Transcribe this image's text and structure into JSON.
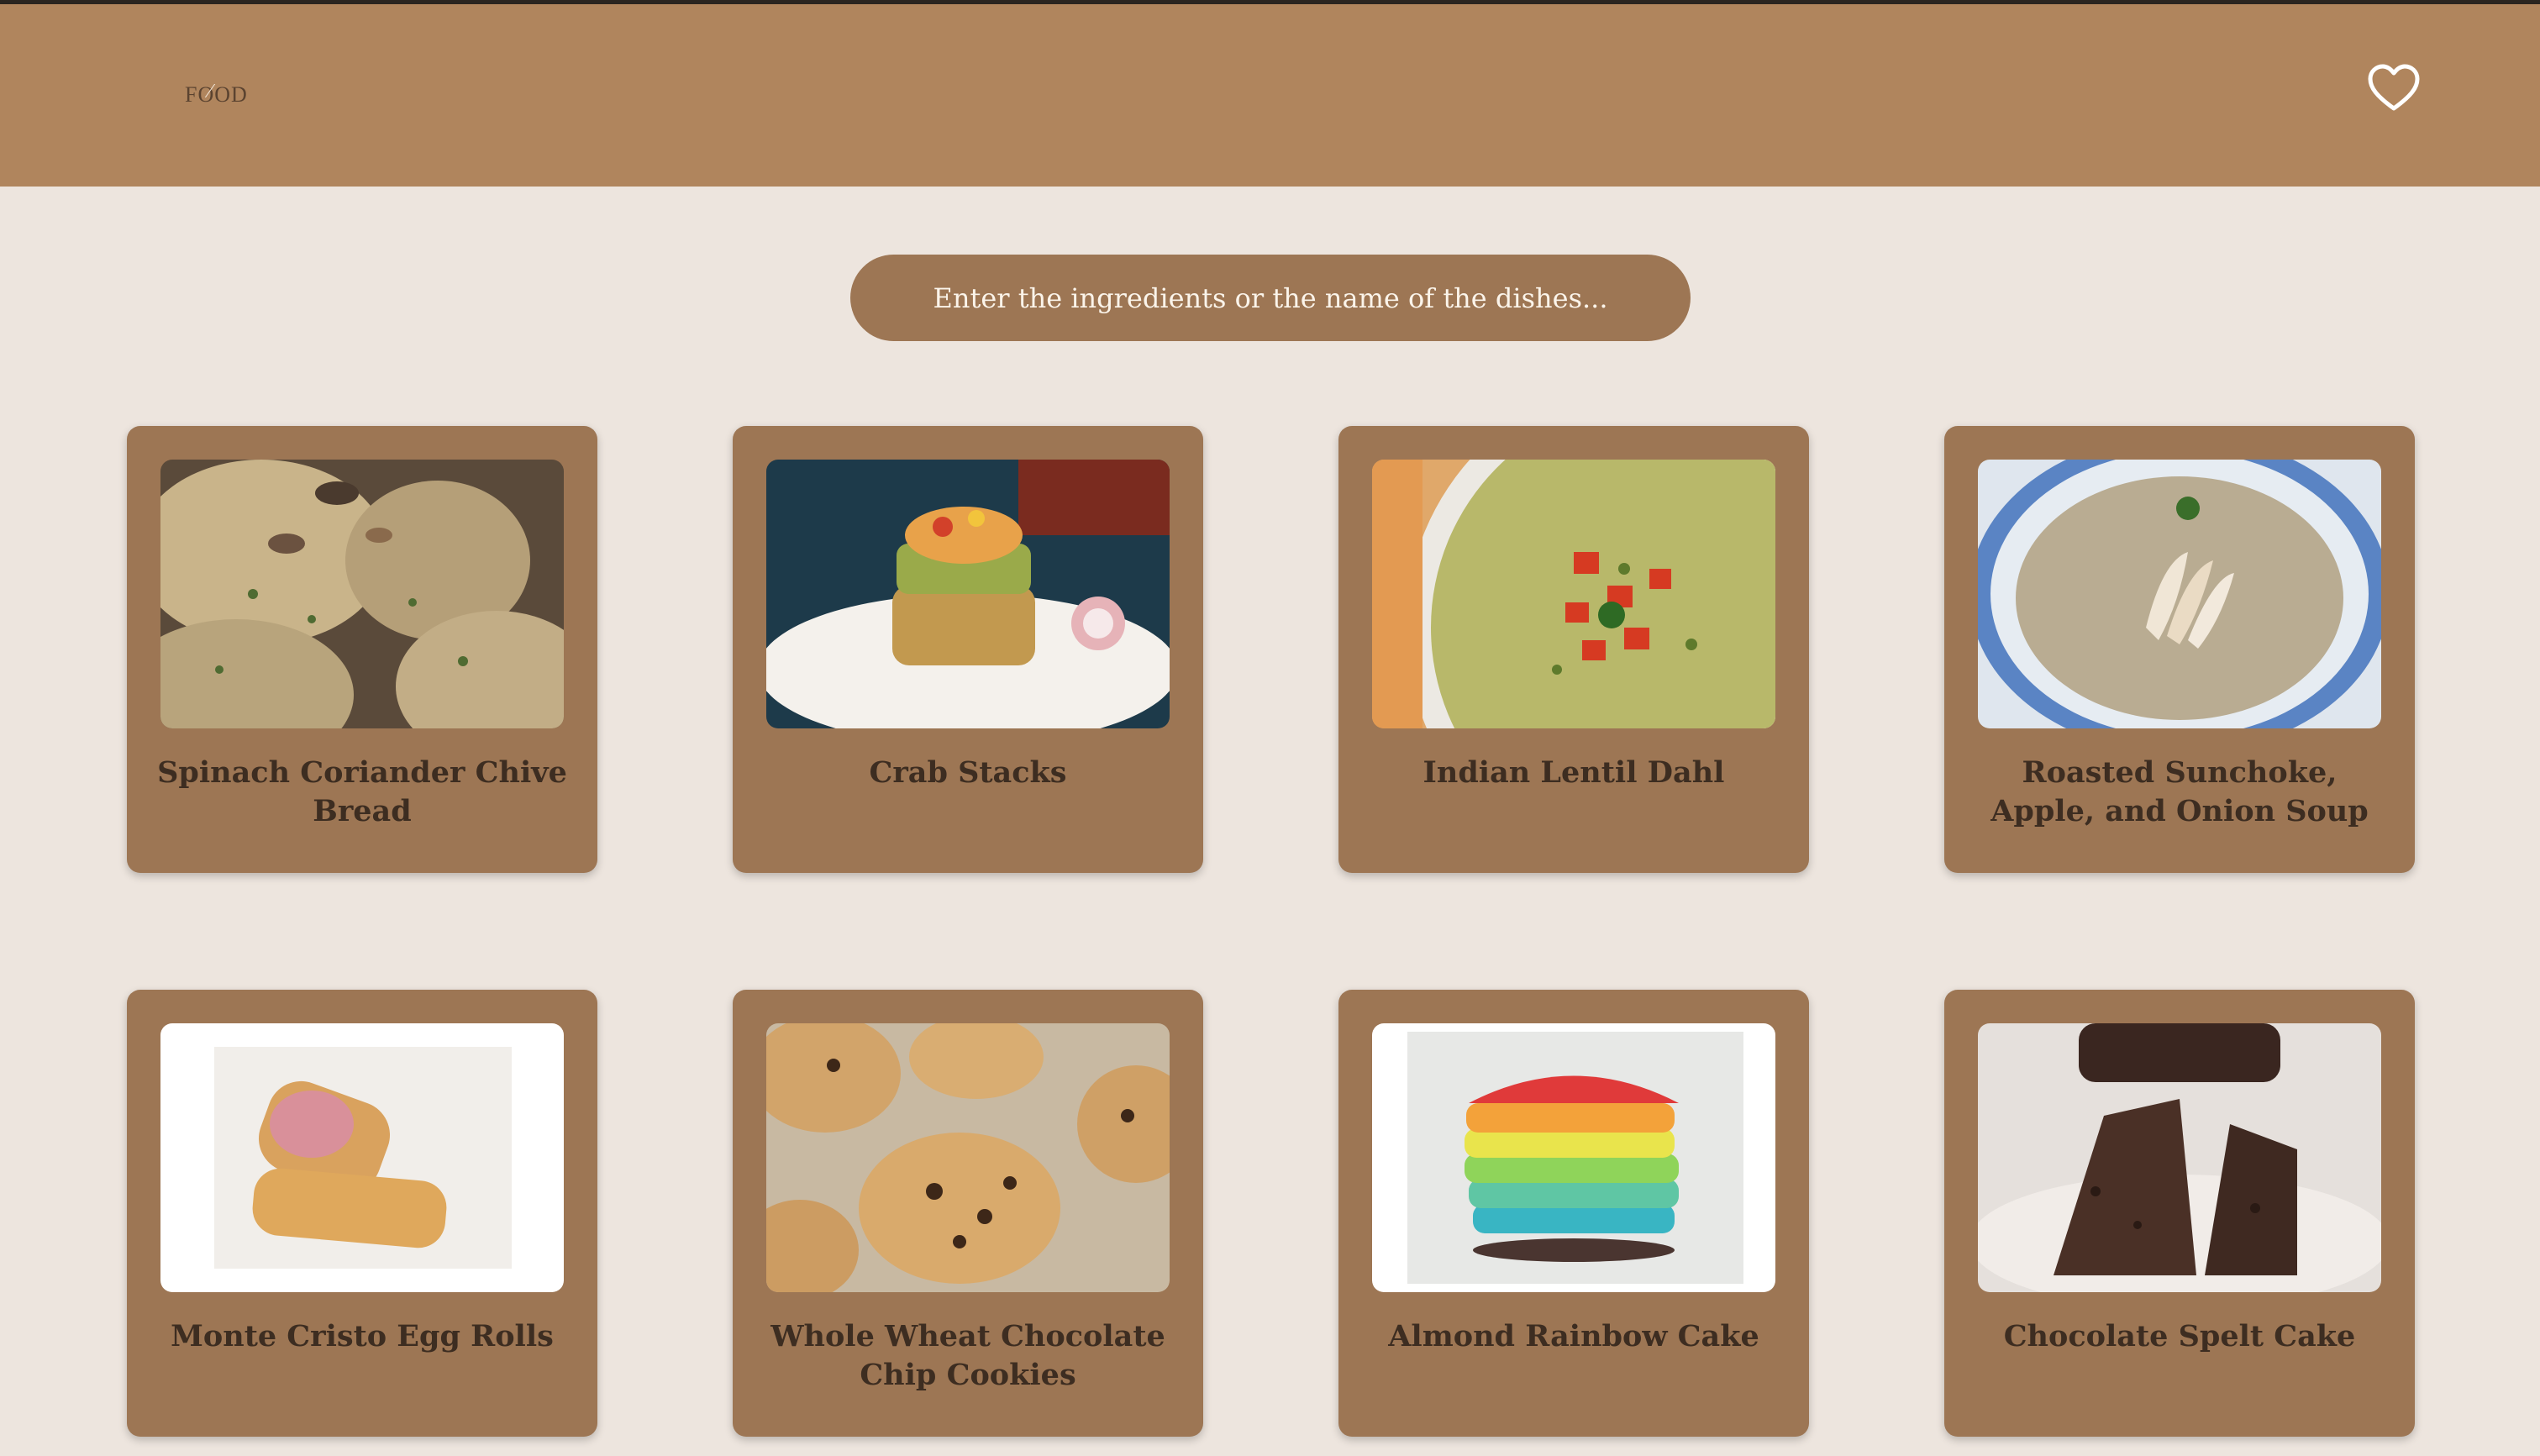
{
  "header": {
    "logo_text": "FOOD",
    "favorites_icon": "heart-outline-icon",
    "background_color": "#b0855d"
  },
  "search": {
    "placeholder": "Enter the ingredients or the name of the dishes..."
  },
  "recipes": [
    {
      "title": "Spinach Coriander Chive Bread",
      "image": "herb bread rolls with seeds"
    },
    {
      "title": "Crab Stacks",
      "image": "stacked crab and quinoa tower on plate"
    },
    {
      "title": "Indian Lentil Dahl",
      "image": "bowl of lentil dahl topped with tomatoes"
    },
    {
      "title": "Roasted Sunchoke, Apple, and Onion Soup",
      "image": "bowl of creamy soup with apple slices"
    },
    {
      "title": "Monte Cristo Egg Rolls",
      "image": "two fried egg rolls with ham"
    },
    {
      "title": "Whole Wheat Chocolate Chip Cookies",
      "image": "chocolate chip cookies on baking mat"
    },
    {
      "title": "Almond Rainbow Cake",
      "image": "stack of rainbow colored cake layers"
    },
    {
      "title": "Chocolate Spelt Cake",
      "image": "sliced chocolate bundt cake on plate"
    }
  ],
  "colors": {
    "page_background": "#ede5de",
    "card_background": "#9d7654",
    "card_title": "#3d2d21",
    "search_background": "#9d7654"
  }
}
